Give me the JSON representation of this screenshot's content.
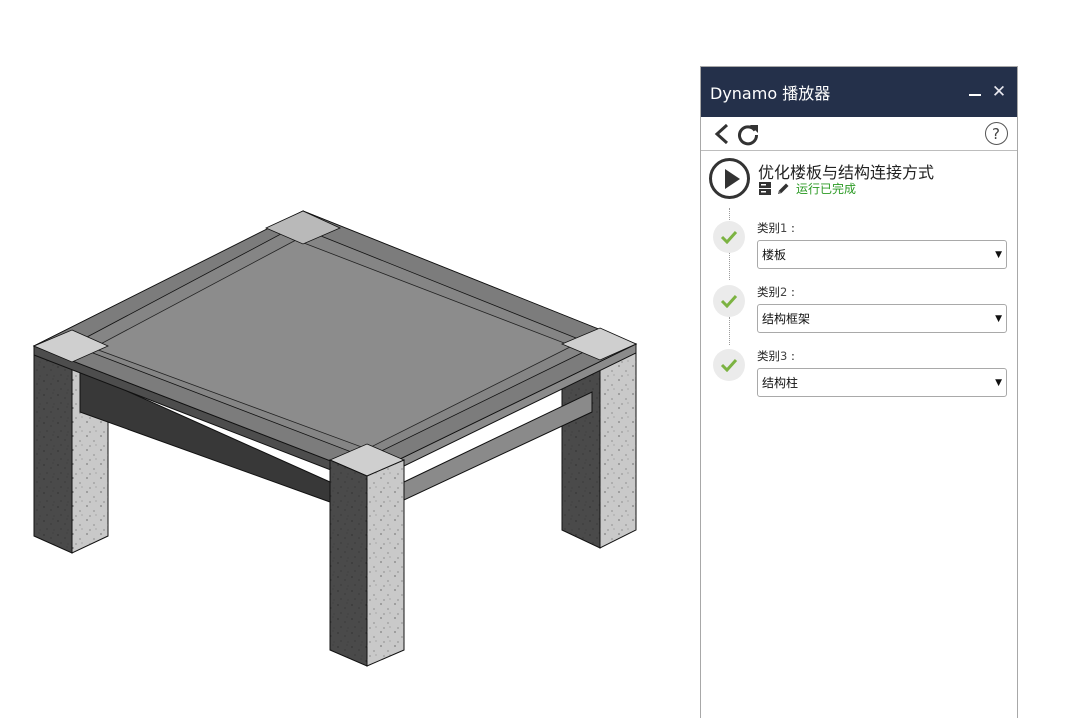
{
  "panel": {
    "title": "Dynamo 播放器",
    "minimize_icon": "minimize-icon",
    "close_icon": "close-icon",
    "close_glyph": "✕"
  },
  "toolbar": {
    "back_icon": "chevron-left-icon",
    "refresh_icon": "refresh-icon",
    "help_icon": "help-icon",
    "help_glyph": "?"
  },
  "script": {
    "name": "优化楼板与结构连接方式",
    "status": "运行已完成",
    "status_color": "#2b9a24"
  },
  "inputs": [
    {
      "label": "类别",
      "index": "1",
      "suffix": " :",
      "value": "楼板",
      "state": "complete"
    },
    {
      "label": "类别",
      "index": "2",
      "suffix": " :",
      "value": "结构框架",
      "state": "complete"
    },
    {
      "label": "类别",
      "index": "3",
      "suffix": " :",
      "value": "结构柱",
      "state": "complete"
    }
  ],
  "colors": {
    "titlebar_bg": "#24304a",
    "check_green": "#7cb342"
  },
  "viewport": {
    "description_icon": "3d-model-view"
  }
}
